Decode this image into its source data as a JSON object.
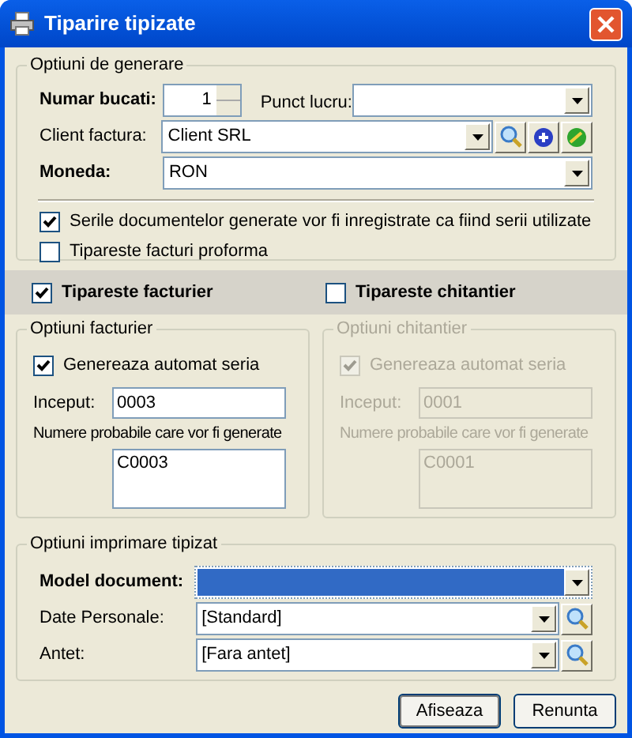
{
  "window": {
    "title": "Tiparire tipizate"
  },
  "generation": {
    "title": "Optiuni de generare",
    "quantity": {
      "label": "Numar bucati:",
      "value": "1",
      "required": true
    },
    "work_point": {
      "label": "Punct lucru:"
    },
    "client": {
      "label": "Client factura:",
      "value": "Client SRL",
      "required": false
    },
    "currency": {
      "label": "Moneda:",
      "value": "RON",
      "required": true
    },
    "options": [
      {
        "label": "Serile documentelor generate vor fi inregistrate ca fiind serii utilizate",
        "checked": true
      },
      {
        "label": "Tipareste facturi proforma",
        "checked": false
      }
    ]
  },
  "print_toggles": [
    {
      "label": "Tipareste facturier",
      "checked": true
    },
    {
      "label": "Tipareste chitantier",
      "checked": false
    }
  ],
  "series_panels": [
    {
      "title": "Optiuni facturier",
      "disabled": false,
      "auto_series": {
        "label": "Genereaza automat seria",
        "checked": true
      },
      "start": {
        "label": "Inceput:",
        "value": "0003"
      },
      "preview": {
        "label": "Numere probabile care vor fi generate",
        "value": "C0003"
      }
    },
    {
      "title": "Optiuni chitantier",
      "disabled": true,
      "auto_series": {
        "label": "Genereaza automat seria",
        "checked": true
      },
      "start": {
        "label": "Inceput:",
        "value": "0001"
      },
      "preview": {
        "label": "Numere probabile care vor fi generate",
        "value": "C0001"
      }
    }
  ],
  "print_options": {
    "title": "Optiuni imprimare tipizat",
    "fields": [
      {
        "label": "Model document:",
        "required": true,
        "selected": true,
        "has_lookup": false
      },
      {
        "label": "Date Personale:",
        "value": "[Standard]",
        "required": false,
        "selected": false,
        "has_lookup": true
      },
      {
        "label": "Antet:",
        "value": "[Fara antet]",
        "required": false,
        "selected": false,
        "has_lookup": true
      }
    ]
  },
  "buttons": [
    "Afiseaza",
    "Renunta"
  ]
}
